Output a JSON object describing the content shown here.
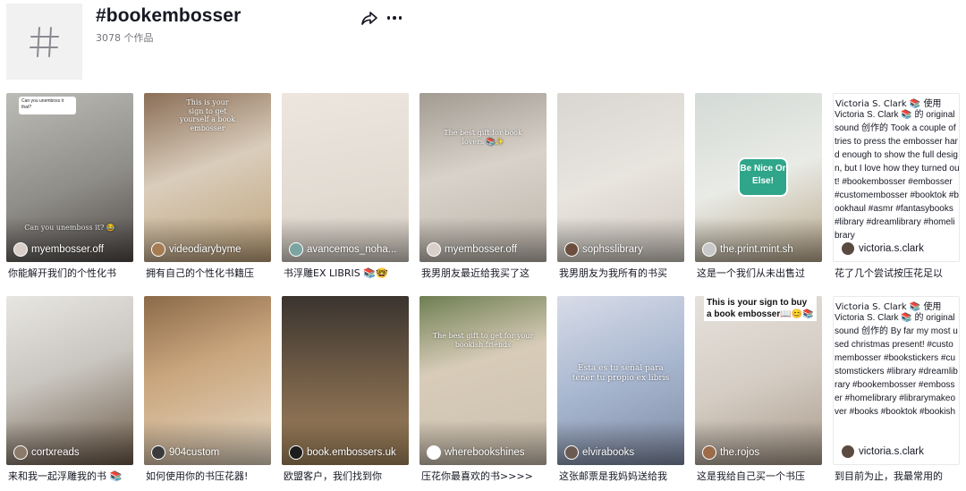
{
  "header": {
    "title": "#bookembosser",
    "subtitle": "3078 个作品",
    "icon": "hashtag-icon",
    "actions": [
      {
        "name": "share",
        "icon": "share-arrow-icon"
      },
      {
        "name": "more",
        "icon": "more-dots-icon"
      }
    ]
  },
  "videos": [
    {
      "author": "myembosser.off",
      "caption": "你能解开我们的个性化书",
      "bg": "linear-gradient(160deg,#bcbcb6 0%,#8f8d88 55%,#4f4a47 100%)",
      "avatar": "#d9cfc8",
      "bubble": "Can you unemboss it that?",
      "overlay": "Can you unemboss it? 😂",
      "overlay_pos": "bottom"
    },
    {
      "author": "videodiarybyme",
      "caption": "拥有自己的个性化书籍压",
      "bg": "linear-gradient(160deg,#8b6e57 0%,#d9cdbb 45%,#bfa27a 100%)",
      "avatar": "#a67c52",
      "overlay": "This is your sign to get yourself a book embosser",
      "overlay_pos": "top"
    },
    {
      "author": "avancemos_noha...",
      "caption": "书浮雕EX LIBRIS 📚🤓",
      "bg": "linear-gradient(170deg,#ece6df 0%,#e2dbd2 60%,#d4ccc3 100%)",
      "avatar": "#7aa5a0"
    },
    {
      "author": "myembosser.off",
      "caption": "我男朋友最近给我买了这",
      "bg": "linear-gradient(165deg,#a29b92 0%,#d8d2ca 45%,#bdb5ab 100%)",
      "avatar": "#d9cfc8",
      "overlay": "The best gift for book lovers 📚✨",
      "overlay_pos": "top2"
    },
    {
      "author": "sophsslibrary",
      "caption": "我男朋友为我所有的书买",
      "bg": "linear-gradient(160deg,#d9d6d1 0%,#e8e4de 50%,#cfc8bf 100%)",
      "avatar": "#6b4e3d"
    },
    {
      "author": "the.print.mint.sh",
      "caption": "这是一个我们从未出售过",
      "bg": "linear-gradient(160deg,#d4dad6 0%,#e9ebe6 50%,#b9a88c 100%)",
      "avatar": "#c8c8c8",
      "badge": "Be Nice Or Else!"
    },
    {
      "text_card": true,
      "author": "victoria.s.clark",
      "caption": "花了几个尝试按压花足以",
      "broken": "Victoria S. Clark 📚 使用",
      "body": "Victoria S. Clark 📚 的 original sound 创作的 Took a couple of tries to press the embosser hard enough to show the full design, but I love how they turned out! #bookembosser #embosser #customembosser #booktok #bookhaul #asmr #fantasybooks #library #dreamlibrary #homelibrary",
      "avatar": "#5a4a3f"
    },
    {
      "author": "cortxreads",
      "caption": "来和我一起浮雕我的书 📚",
      "bg": "linear-gradient(160deg,#e8e6e2 0%,#c9c6c0 45%,#6d5a48 100%)",
      "avatar": "#8a7a6a"
    },
    {
      "author": "904custom",
      "caption": "如何使用你的书压花器!",
      "bg": "linear-gradient(160deg,#8b6a4a 0%,#c9a57c 40%,#e6d9c5 100%)",
      "avatar": "#3b3b3b"
    },
    {
      "author": "book.embossers.uk",
      "caption": "欧盟客户，我们找到你",
      "bg": "linear-gradient(180deg,#3a342f 0%,#6e5a45 45%,#a6875f 100%)",
      "avatar": "#1c1c1c"
    },
    {
      "author": "wherebookshines",
      "caption": "压花你最喜欢的书>>>>",
      "bg": "linear-gradient(165deg,#6f7f52 0%,#d8ccb9 40%,#cbbfae 100%)",
      "avatar": "#ffffff",
      "overlay": "The best gift to get for your bookish friends",
      "overlay_pos": "top2"
    },
    {
      "author": "elvirabooks",
      "caption": "这张邮票是我妈妈送给我",
      "bg": "linear-gradient(160deg,#d8dce8 0%,#a7b6cf 50%,#7f8aa3 100%)",
      "avatar": "#6a5a52",
      "overlay": "Esta es tu señal para tener tu propio ex libris",
      "overlay_pos": "middle"
    },
    {
      "author": "the.rojos",
      "caption": "这是我给自己买一个书压",
      "bg": "linear-gradient(160deg,#e6e1dc 0%,#d5cdc4 50%,#a99a8a 100%)",
      "avatar": "#9b6b4a",
      "banner": "This is your sign to buy a book embosser📖😊📚"
    },
    {
      "text_card": true,
      "author": "victoria.s.clark",
      "caption": "到目前为止，我最常用的",
      "broken": "Victoria S. Clark 📚 使用",
      "body": "Victoria S. Clark 📚 的 original sound 创作的 By far my most used christmas present! #customembosser #bookstickers #customstickers #library #dreamlibrary #bookembosser #embosser #homelibrary #librarymakeover #books #booktok #bookish",
      "avatar": "#5a4a3f"
    }
  ]
}
